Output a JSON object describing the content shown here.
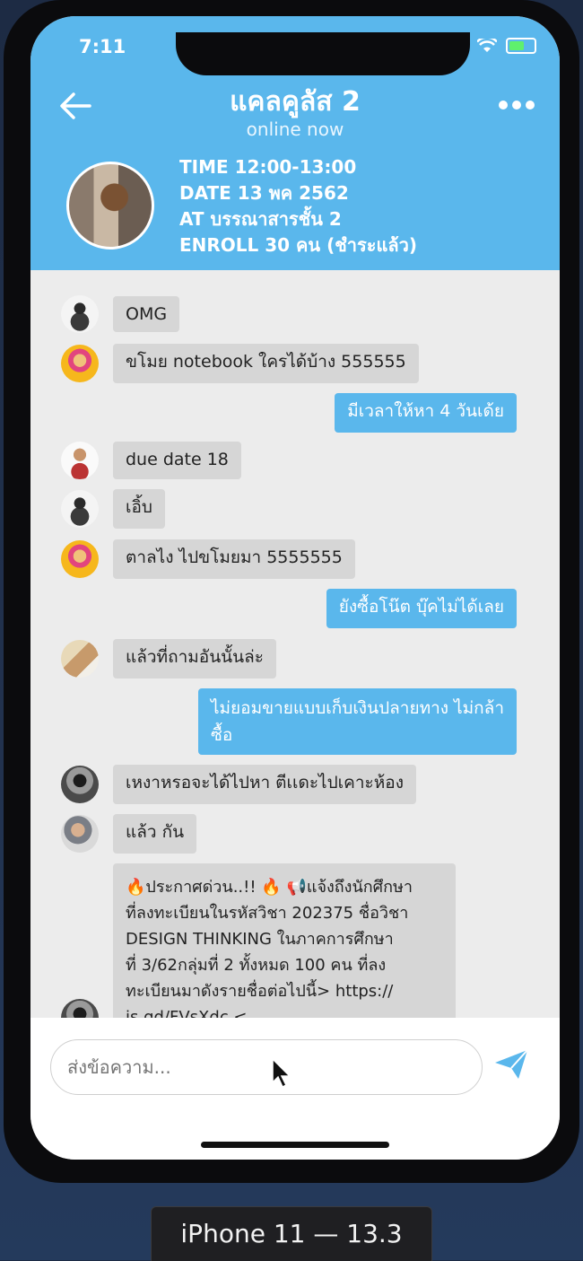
{
  "status": {
    "time": "7:11"
  },
  "header": {
    "title": "แคลคูลัส 2",
    "subtitle": "online now",
    "info": [
      "TIME 12:00-13:00",
      "DATE 13 พค 2562",
      "AT บรรณาสารชั้น 2",
      "ENROLL 30 คน (ชำระแล้ว)"
    ]
  },
  "messages": [
    {
      "side": "in",
      "avatar": "avatar-ninja",
      "text": "OMG"
    },
    {
      "side": "in",
      "avatar": "avatar-pink",
      "text": "ขโมย notebook ใครได้บ้าง 555555"
    },
    {
      "side": "out",
      "text": "มีเวลาให้หา 4 วันเด้ย"
    },
    {
      "side": "in",
      "avatar": "avatar-man-red",
      "text": "due date 18"
    },
    {
      "side": "in",
      "avatar": "avatar-ninja",
      "text": "เอิ้บ"
    },
    {
      "side": "in",
      "avatar": "avatar-pink",
      "text": "ตาลไง ไปขโมยมา 5555555"
    },
    {
      "side": "out",
      "text": "ยังซื้อโน๊ต บุ๊คไม่ได้เลย"
    },
    {
      "side": "in",
      "avatar": "avatar-couple",
      "text": "แล้วที่ถามอันนั้นล่ะ"
    },
    {
      "side": "out",
      "text": "ไม่ยอมขายแบบเก็บเงินปลายทาง ไม่กล้า\nซื้อ"
    },
    {
      "side": "in",
      "avatar": "avatar-gym",
      "text": "เหงาหรอจะได้ไปหา ตีเเดะไปเคาะห้อง"
    },
    {
      "side": "in",
      "avatar": "avatar-selfie",
      "text": "แล้ว กัน"
    },
    {
      "side": "in",
      "avatar": "avatar-gym",
      "text": "🔥ประกาศด่วน..!! 🔥 📢แจ้งถึงนักศึกษา\nที่ลงทะเบียนในรหัสวิชา 202375 ชื่อวิชา\nDESIGN THINKING ในภาคการศึกษา\nที่ 3/62กลุ่มที่ 2 ทั้งหมด 100 คน ที่ลง\nทะเบียนมาดังรายชื่อต่อไปนี้> https://\nis.gd/FVsXdc <"
    }
  ],
  "composer": {
    "placeholder": "ส่งข้อความ..."
  },
  "device_label": "iPhone 11 — 13.3",
  "colors": {
    "accent": "#5ab7ec",
    "incoming": "#d6d6d6",
    "background": "#ececec"
  },
  "icons": [
    "back-arrow-icon",
    "more-icon",
    "wifi-icon",
    "battery-icon",
    "send-icon",
    "cursor-icon"
  ]
}
